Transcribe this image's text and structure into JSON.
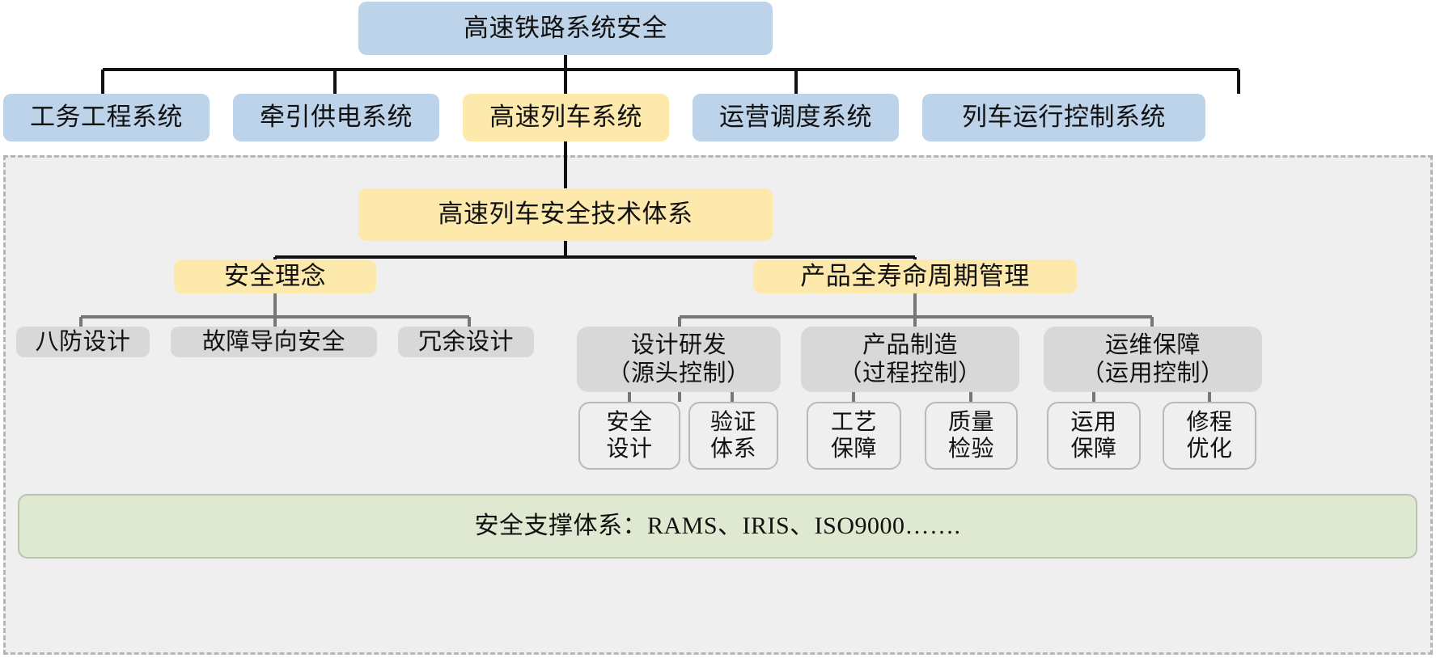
{
  "diagram": {
    "title": "高速铁路系统安全",
    "type": "hierarchy-tree",
    "root": {
      "label": "高速铁路系统安全",
      "color": "#bdd3ea"
    },
    "systems": [
      {
        "label": "工务工程系统",
        "color": "#bdd3ea",
        "highlighted": false
      },
      {
        "label": "牵引供电系统",
        "color": "#bdd3ea",
        "highlighted": false
      },
      {
        "label": "高速列车系统",
        "color": "#fde9ab",
        "highlighted": true
      },
      {
        "label": "运营调度系统",
        "color": "#bdd3ea",
        "highlighted": false
      },
      {
        "label": "列车运行控制系统",
        "color": "#bdd3ea",
        "highlighted": false
      }
    ],
    "framework": {
      "label": "高速列车安全技术体系",
      "color": "#fde9ab"
    },
    "branches": [
      {
        "label": "安全理念",
        "color": "#fde9ab",
        "children": [
          {
            "label": "八防设计"
          },
          {
            "label": "故障导向安全"
          },
          {
            "label": "冗余设计"
          }
        ]
      },
      {
        "label": "产品全寿命周期管理",
        "color": "#fde9ab",
        "children": [
          {
            "line1": "设计研发",
            "line2": "（源头控制）",
            "leaves": [
              {
                "line1": "安全",
                "line2": "设计"
              },
              {
                "line1": "验证",
                "line2": "体系"
              }
            ]
          },
          {
            "line1": "产品制造",
            "line2": "（过程控制）",
            "leaves": [
              {
                "line1": "工艺",
                "line2": "保障"
              },
              {
                "line1": "质量",
                "line2": "检验"
              }
            ]
          },
          {
            "line1": "运维保障",
            "line2": "（运用控制）",
            "leaves": [
              {
                "line1": "运用",
                "line2": "保障"
              },
              {
                "line1": "修程",
                "line2": "优化"
              }
            ]
          }
        ]
      }
    ],
    "support_band": {
      "label": "安全支撑体系：RAMS、IRIS、ISO9000…….",
      "color": "#dfe9d2"
    },
    "colors": {
      "blue": "#bdd3ea",
      "yellow": "#fde9ab",
      "grey": "#d8d8d8",
      "leaf": "#efefef",
      "green": "#dfe9d2",
      "zone_bg": "#efefef",
      "zone_border": "#b6b6b6",
      "edge_black": "#111111",
      "edge_grey": "#777777"
    }
  }
}
